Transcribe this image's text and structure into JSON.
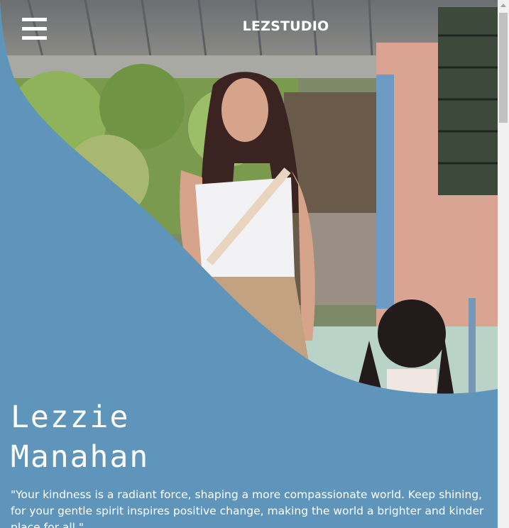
{
  "header": {
    "brand": "LEZSTUDIO",
    "menu_icon": "hamburger-menu-icon"
  },
  "hero": {
    "photo_description_icon": "portrait-photo",
    "name_first": "Lezzie",
    "name_last": "Manahan",
    "quote": "\"Your kindness is a radiant force, shaping a more compassionate world. Keep shining, for your gentle spirit inspires positive change, making the world a brighter and kinder place for all.\""
  },
  "colors": {
    "accent_blue": "#5f95bb",
    "text": "#ffffff"
  }
}
